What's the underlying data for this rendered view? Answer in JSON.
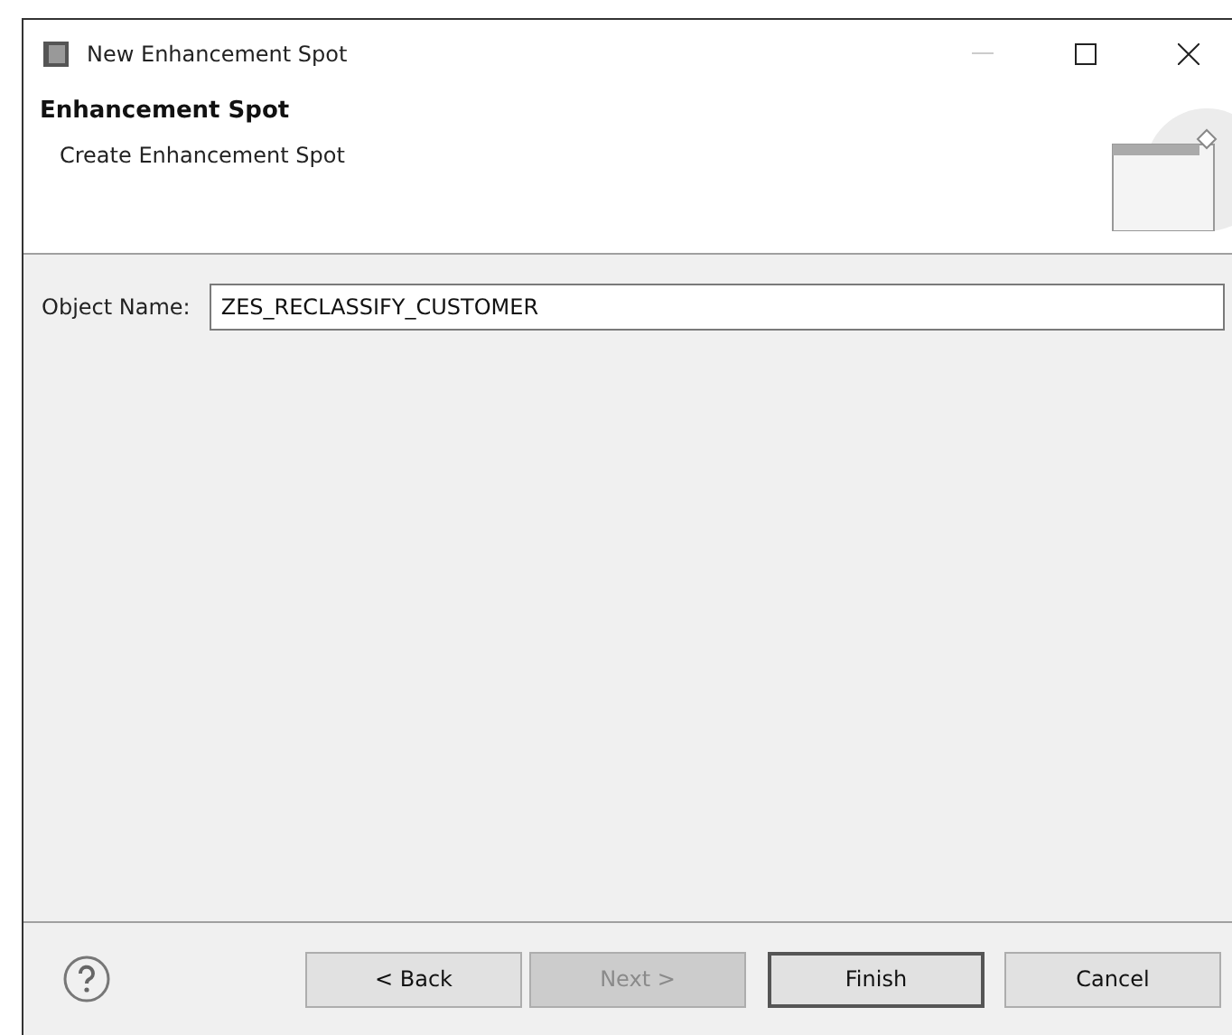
{
  "window": {
    "title": "New Enhancement Spot"
  },
  "header": {
    "title": "Enhancement Spot",
    "description": "Create Enhancement Spot"
  },
  "form": {
    "label": "Object Name:",
    "value": "ZES_RECLASSIFY_CUSTOMER"
  },
  "buttons": [
    {
      "label": "< Back",
      "disabled": false,
      "default": false
    },
    {
      "label": "Next >",
      "disabled": true,
      "default": false
    },
    {
      "label": "Finish",
      "disabled": false,
      "default": true
    },
    {
      "label": "Cancel",
      "disabled": false,
      "default": false
    }
  ]
}
